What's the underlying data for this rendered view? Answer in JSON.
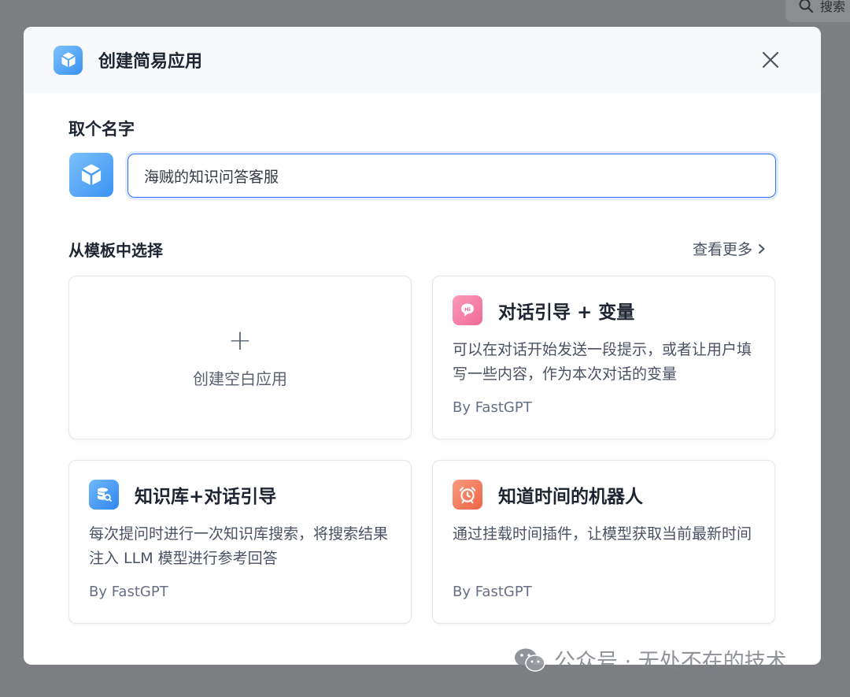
{
  "background": {
    "search_text": "搜索"
  },
  "dialog": {
    "title": "创建简易应用",
    "name_section_label": "取个名字",
    "name_input_value": "海贼的知识问答客服",
    "template_section_label": "从模板中选择",
    "view_more_label": "查看更多",
    "blank_card": {
      "plus": "+",
      "label": "创建空白应用"
    },
    "templates": [
      {
        "title": "对话引导 + 变量",
        "desc": "可以在对话开始发送一段提示，或者让用户填写一些内容，作为本次对话的变量",
        "author": "By FastGPT",
        "icon": "hi-chat-icon",
        "icon_badge": "Hi",
        "color": "#f7739f"
      },
      {
        "title": "知识库+对话引导",
        "desc": "每次提问时进行一次知识库搜索，将搜索结果注入 LLM 模型进行参考回答",
        "author": "By FastGPT",
        "icon": "database-search-icon",
        "color": "#3a93f2"
      },
      {
        "title": "知道时间的机器人",
        "desc": "通过挂载时间插件，让模型获取当前最新时间",
        "author": "By FastGPT",
        "icon": "alarm-clock-icon",
        "color": "#f0735a"
      }
    ]
  },
  "watermark": {
    "text": "公众号 · 无处不在的技术"
  },
  "colors": {
    "primary": "#3370ff",
    "overlay": "#7d7e82",
    "header_bg": "#f7f8fa"
  }
}
